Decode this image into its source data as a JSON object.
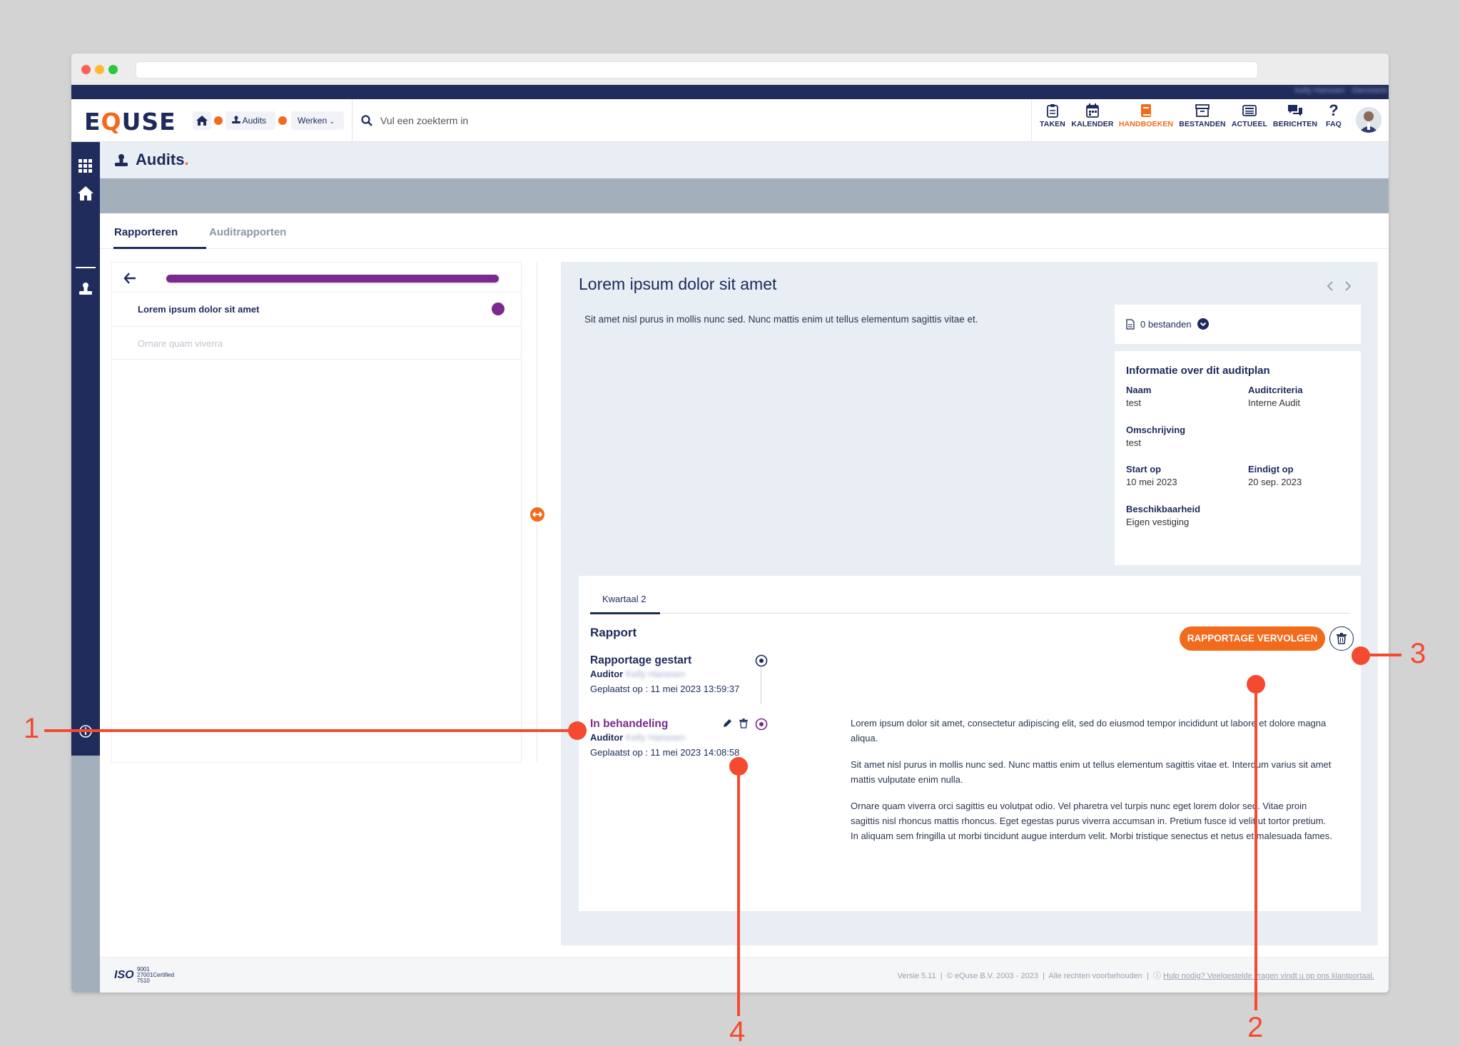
{
  "app": {
    "logo": "EQUSE",
    "user_name": "Kelly Hanssen · Dienstarts"
  },
  "breadcrumb": {
    "home_icon": "home-icon",
    "audits_label": "Audits",
    "werken_label": "Werken"
  },
  "search": {
    "placeholder": "Vul een zoekterm in"
  },
  "nav": [
    {
      "label": "TAKEN",
      "icon": "clipboard-icon"
    },
    {
      "label": "KALENDER",
      "icon": "calendar-icon"
    },
    {
      "label": "HANDBOEKEN",
      "icon": "book-icon",
      "active": true
    },
    {
      "label": "BESTANDEN",
      "icon": "archive-icon"
    },
    {
      "label": "ACTUEEL",
      "icon": "newspaper-icon"
    },
    {
      "label": "BERICHTEN",
      "icon": "chat-icon"
    },
    {
      "label": "FAQ",
      "icon": "question-icon"
    }
  ],
  "page": {
    "title": "Audits",
    "title_dot": "."
  },
  "tabs": [
    "Rapporteren",
    "Auditrapporten"
  ],
  "left_panel": {
    "items": [
      {
        "label": "Lorem ipsum dolor sit amet",
        "active": true
      },
      {
        "label": "Ornare quam viverra",
        "active": false
      }
    ]
  },
  "detail": {
    "title": "Lorem ipsum dolor sit amet",
    "description": "Sit amet nisl purus in mollis nunc sed. Nunc mattis enim ut tellus elementum sagittis vitae et.",
    "files_label": "0 bestanden",
    "info": {
      "heading": "Informatie over dit auditplan",
      "naam_label": "Naam",
      "naam_value": "test",
      "criteria_label": "Auditcriteria",
      "criteria_value": "Interne Audit",
      "omschrijving_label": "Omschrijving",
      "omschrijving_value": "test",
      "start_label": "Start op",
      "start_value": "10 mei 2023",
      "eind_label": "Eindigt op",
      "eind_value": "20 sep. 2023",
      "beschik_label": "Beschikbaarheid",
      "beschik_value": "Eigen vestiging"
    },
    "report": {
      "tab": "Kwartaal 2",
      "heading": "Rapport",
      "continue_button": "RAPPORTAGE VERVOLGEN",
      "timeline": [
        {
          "title": "Rapportage gestart",
          "auditor_label": "Auditor",
          "auditor_name": "Kelly Hanssen",
          "posted": "Geplaatst op : 11 mei 2023 13:59:37"
        },
        {
          "title": "In behandeling",
          "auditor_label": "Auditor",
          "auditor_name": "Kelly Hanssen",
          "posted": "Geplaatst op : 11 mei 2023 14:08:58"
        }
      ],
      "paragraphs": [
        "Lorem ipsum dolor sit amet, consectetur adipiscing elit, sed do eiusmod tempor incididunt ut labore et dolore magna aliqua.",
        "Sit amet nisl purus in mollis nunc sed. Nunc mattis enim ut tellus elementum sagittis vitae et. Interdum varius sit amet mattis vulputate enim nulla.",
        "Ornare quam viverra orci sagittis eu volutpat odio. Vel pharetra vel turpis nunc eget lorem dolor sed. Vitae proin sagittis nisl rhoncus mattis rhoncus. Eget egestas purus viverra accumsan in. Pretium fusce id velit ut tortor pretium. In aliquam sem fringilla ut morbi tincidunt augue interdum velit. Morbi tristique senectus et netus et malesuada fames."
      ]
    }
  },
  "footer": {
    "iso": "ISO",
    "iso_numbers": [
      "9001",
      "27001",
      "7510"
    ],
    "iso_certified": "Certified",
    "version": "Versie 5.11",
    "copyright": "© eQuse B.V. 2003 - 2023",
    "rights": "Alle rechten voorbehouden",
    "help": "Hulp nodig? Veelgestelde vragen vindt u op ons klantportaal."
  },
  "annotations": [
    "1",
    "2",
    "3",
    "4"
  ],
  "colors": {
    "navy": "#1f2c5c",
    "orange": "#f26a1b",
    "purple": "#7a2a8c",
    "annotation": "#f44a2f"
  }
}
